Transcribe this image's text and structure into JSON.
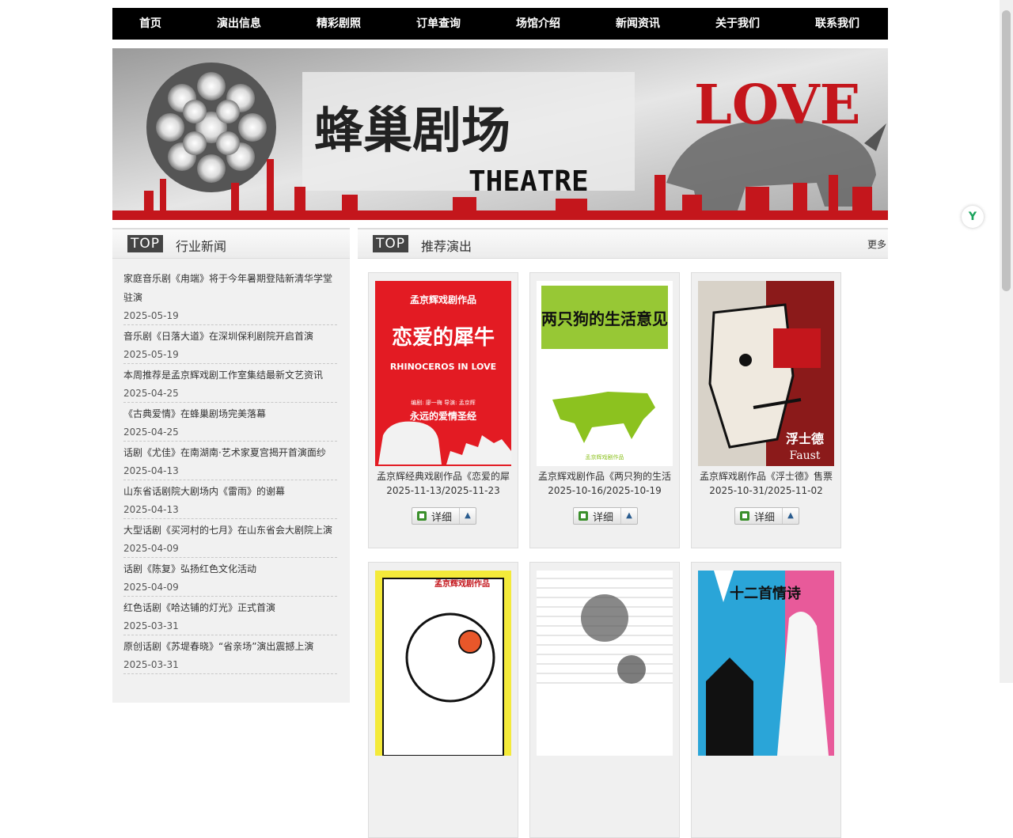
{
  "nav": {
    "items": [
      "首页",
      "演出信息",
      "精彩剧照",
      "订单查询",
      "场馆介绍",
      "新闻资讯",
      "关于我们",
      "联系我们"
    ]
  },
  "banner": {
    "title_cn": "蜂巢剧场",
    "title_en": "THEATRE",
    "love_text": "LOVE"
  },
  "left": {
    "badge": "TOP",
    "title": "行业新闻",
    "news": [
      {
        "title": "家庭音乐剧《甪端》将于今年暑期登陆新清华学堂驻演",
        "date": "2025-05-19"
      },
      {
        "title": "音乐剧《日落大道》在深圳保利剧院开启首演",
        "date": "2025-05-19"
      },
      {
        "title": "本周推荐是孟京辉戏剧工作室集结最新文艺资讯",
        "date": "2025-04-25"
      },
      {
        "title": "《古典爱情》在蜂巢剧场完美落幕",
        "date": "2025-04-25"
      },
      {
        "title": "话剧《尤佳》在南湖南·艺术家夏宫揭开首演面纱",
        "date": "2025-04-13"
      },
      {
        "title": "山东省话剧院大剧场内《雷雨》的谢幕",
        "date": "2025-04-13"
      },
      {
        "title": "大型话剧《买河村的七月》在山东省会大剧院上演",
        "date": "2025-04-09"
      },
      {
        "title": "话剧《陈复》弘扬红色文化活动",
        "date": "2025-04-09"
      },
      {
        "title": "红色话剧《哈达铺的灯光》正式首演",
        "date": "2025-03-31"
      },
      {
        "title": "原创话剧《苏堤春晓》“省亲场”演出震撼上演",
        "date": "2025-03-31"
      }
    ]
  },
  "right": {
    "badge": "TOP",
    "title": "推荐演出",
    "more": "更多",
    "detail_label": "详细",
    "shows": [
      {
        "title": "孟京辉经典戏剧作品《恋爱的犀",
        "date": "2025-11-13/2025-11-23",
        "poster_top": "孟京辉戏剧作品",
        "poster_main": "恋爱的犀牛",
        "poster_en": "RHINOCEROS IN LOVE",
        "poster_sub": "永远的爱情圣经",
        "poster_small": "编剧: 廖一梅  导演: 孟京辉"
      },
      {
        "title": "孟京辉戏剧作品《两只狗的生活",
        "date": "2025-10-16/2025-10-19",
        "poster_main": "两只狗的生活意见",
        "poster_small": "孟京辉戏剧作品"
      },
      {
        "title": "孟京辉戏剧作品《浮士德》售票",
        "date": "2025-10-31/2025-11-02",
        "poster_main": "浮士德",
        "poster_en": "Faust"
      },
      {
        "title": "",
        "date": "",
        "poster_top": "孟京辉戏剧作品"
      },
      {
        "title": "",
        "date": ""
      },
      {
        "title": "",
        "date": "",
        "poster_main": "十二首情诗"
      }
    ]
  }
}
